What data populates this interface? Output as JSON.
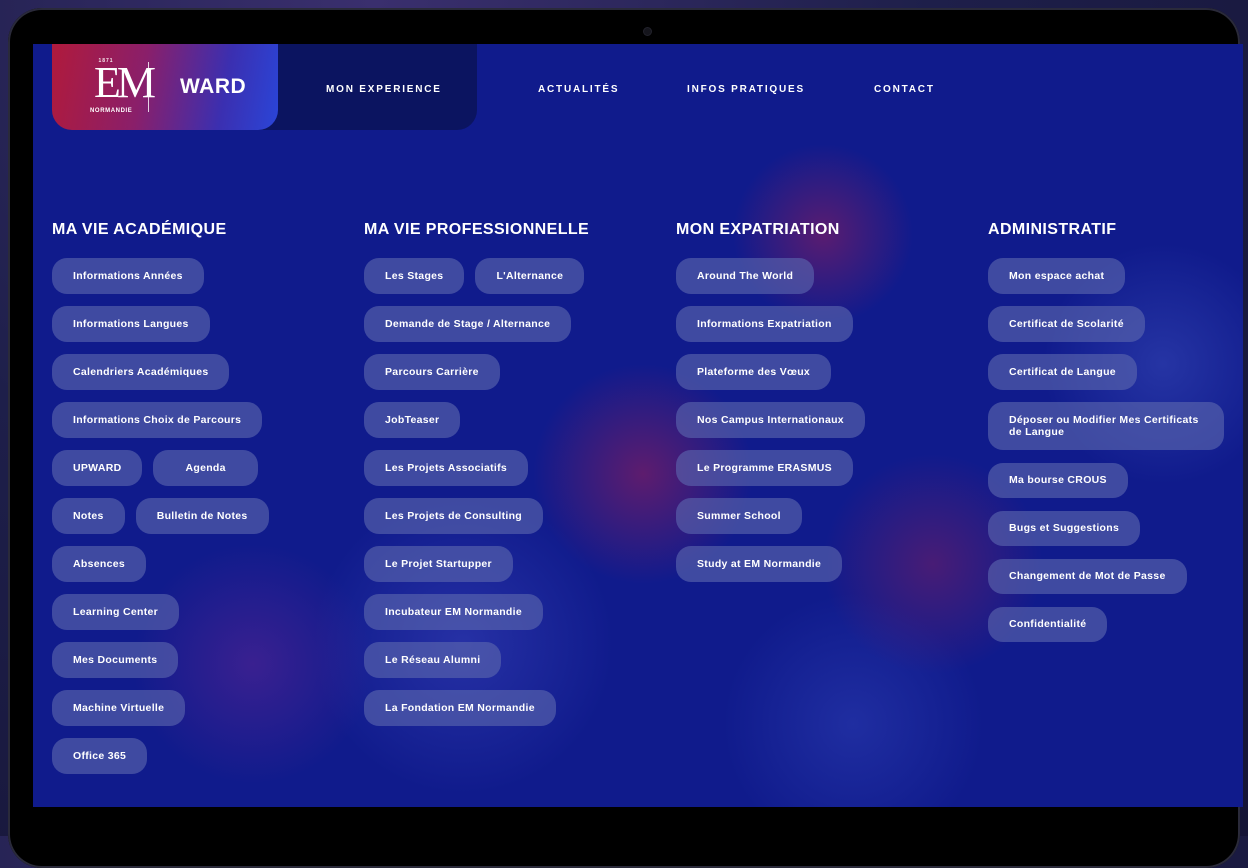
{
  "brand": {
    "logo_year": "1871",
    "logo_mark": "EM",
    "logo_city": "NORMANDIE",
    "word": "WARD",
    "gradient_colors": [
      "#b01a3c",
      "#2a45d8"
    ]
  },
  "nav": {
    "items": [
      {
        "label": "MON EXPERIENCE",
        "active": true
      },
      {
        "label": "ACTUALITÉS"
      },
      {
        "label": "INFOS PRATIQUES"
      },
      {
        "label": "CONTACT"
      }
    ]
  },
  "columns": [
    {
      "title": "MA VIE ACADÉMIQUE",
      "rows": [
        [
          "Informations Années"
        ],
        [
          "Informations Langues"
        ],
        [
          "Calendriers Académiques"
        ],
        [
          "Informations Choix de Parcours"
        ],
        [
          "UPWARD",
          "Agenda"
        ],
        [
          "Notes",
          "Bulletin de Notes"
        ],
        [
          "Absences"
        ],
        [
          "Learning Center"
        ],
        [
          "Mes Documents"
        ],
        [
          "Machine Virtuelle"
        ],
        [
          "Office 365"
        ]
      ]
    },
    {
      "title": "MA VIE PROFESSIONNELLE",
      "rows": [
        [
          "Les Stages",
          "L'Alternance"
        ],
        [
          "Demande de Stage / Alternance"
        ],
        [
          "Parcours Carrière"
        ],
        [
          "JobTeaser"
        ],
        [
          "Les Projets Associatifs"
        ],
        [
          "Les Projets de Consulting"
        ],
        [
          "Le Projet Startupper"
        ],
        [
          "Incubateur EM Normandie"
        ],
        [
          "Le Réseau Alumni"
        ],
        [
          "La Fondation EM Normandie"
        ]
      ]
    },
    {
      "title": "MON EXPATRIATION",
      "rows": [
        [
          "Around The World"
        ],
        [
          "Informations Expatriation"
        ],
        [
          "Plateforme des Vœux"
        ],
        [
          "Nos Campus Internationaux"
        ],
        [
          "Le Programme ERASMUS"
        ],
        [
          "Summer School"
        ],
        [
          "Study at EM Normandie"
        ]
      ]
    },
    {
      "title": "ADMINISTRATIF",
      "rows": [
        [
          "Mon espace achat"
        ],
        [
          "Certificat de Scolarité"
        ],
        [
          "Certificat de Langue"
        ],
        [
          "Déposer ou Modifier Mes Certificats de Langue"
        ],
        [
          "Ma bourse CROUS"
        ],
        [
          "Bugs et Suggestions"
        ],
        [
          "Changement de Mot de Passe"
        ],
        [
          "Confidentialité"
        ]
      ]
    }
  ],
  "colors": {
    "background": "#101b8c",
    "pill": "#5c67af",
    "nav_active_bg": "#0b1460"
  }
}
